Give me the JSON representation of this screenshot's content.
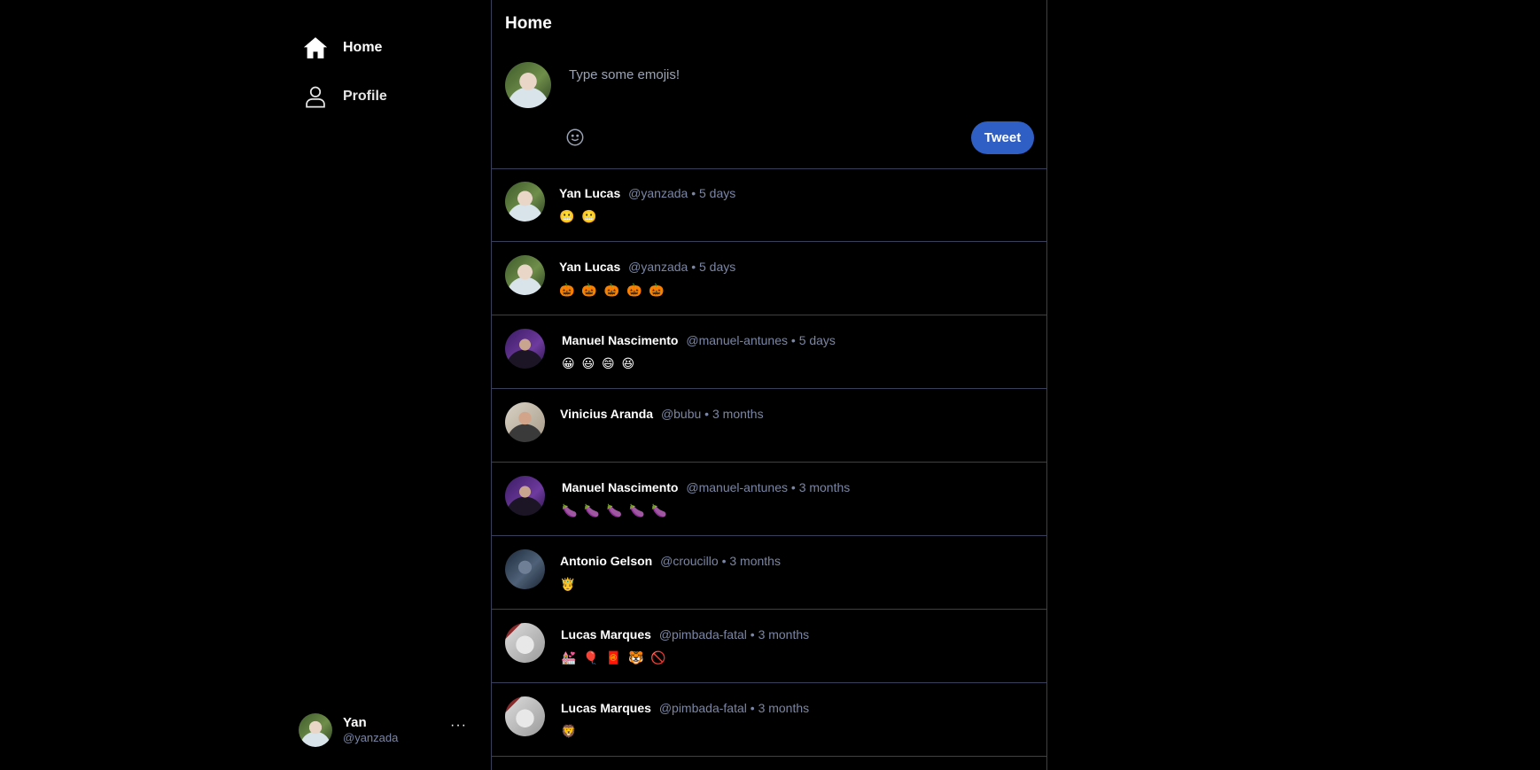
{
  "nav": {
    "items": [
      {
        "label": "Home",
        "icon": "home-icon",
        "active": true
      },
      {
        "label": "Profile",
        "icon": "user-icon",
        "active": false
      }
    ]
  },
  "account": {
    "name": "Yan",
    "handle": "@yanzada",
    "more": "···"
  },
  "main": {
    "title": "Home"
  },
  "composer": {
    "placeholder": "Type some emojis!",
    "emoji_icon": "smiley-icon",
    "tweet_label": "Tweet"
  },
  "colors": {
    "background": "#000000",
    "border": "#3a3f5c",
    "muted": "#7b86a5",
    "accent": "#2f5fc4"
  },
  "feed": [
    {
      "author": "Yan Lucas",
      "handle": "@yanzada",
      "time": "5 days",
      "content": "😬 😬"
    },
    {
      "author": "Yan Lucas",
      "handle": "@yanzada",
      "time": "5 days",
      "content": "🎃 🎃 🎃 🎃 🎃"
    },
    {
      "author": "Manuel Nascimento",
      "handle": "@manuel-antunes",
      "time": "5 days",
      "content": "😀 😃 😄 😆"
    },
    {
      "author": "Vinicius Aranda",
      "handle": "@bubu",
      "time": "3 months",
      "content": ""
    },
    {
      "author": "Manuel Nascimento",
      "handle": "@manuel-antunes",
      "time": "3 months",
      "content": "🍆 🍆 🍆 🍆 🍆"
    },
    {
      "author": "Antonio Gelson",
      "handle": "@croucillo",
      "time": "3 months",
      "content": "🤴"
    },
    {
      "author": "Lucas Marques",
      "handle": "@pimbada-fatal",
      "time": "3 months",
      "content": "💒 🎈 🧧 🐯 🚫"
    },
    {
      "author": "Lucas Marques",
      "handle": "@pimbada-fatal",
      "time": "3 months",
      "content": "🦁"
    }
  ]
}
